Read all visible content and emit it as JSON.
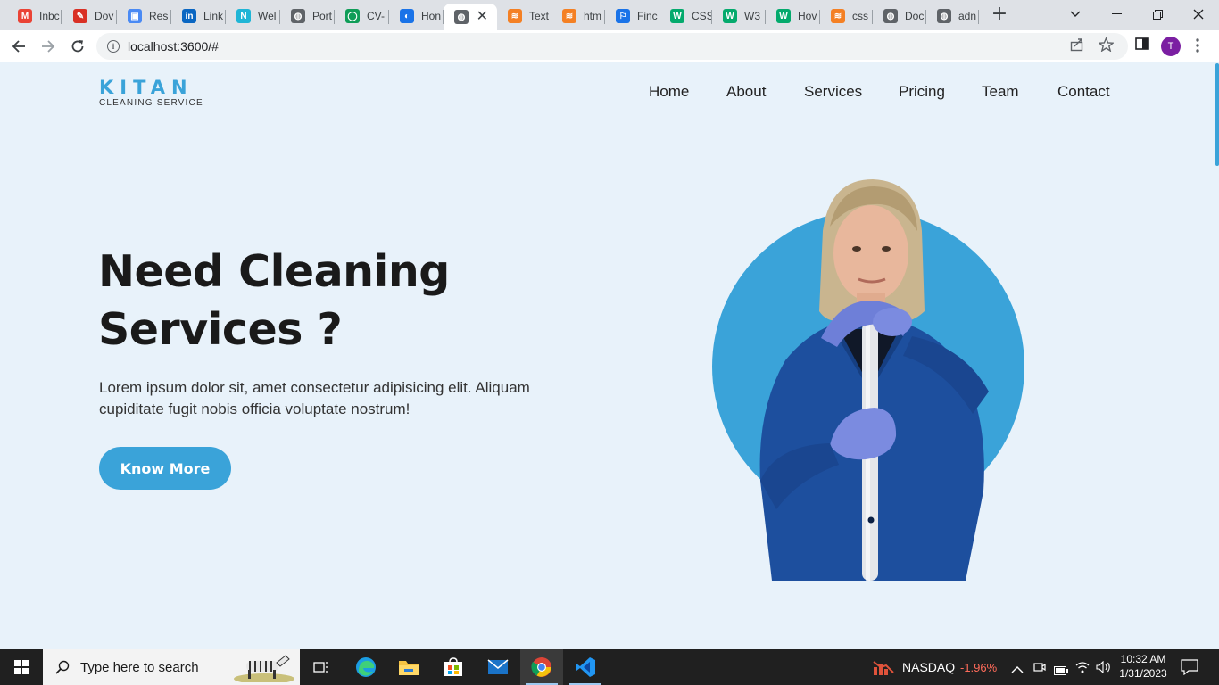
{
  "browser": {
    "tabs": [
      {
        "label": "Inbc",
        "icon": "gmail-icon",
        "color": "#ea4335",
        "glyph": "M"
      },
      {
        "label": "Dov",
        "icon": "pdf-icon",
        "color": "#d93025",
        "glyph": "✎"
      },
      {
        "label": "Res",
        "icon": "resume-icon",
        "color": "#4a8af4",
        "glyph": "▣"
      },
      {
        "label": "Link",
        "icon": "linkedin-icon",
        "color": "#0a66c2",
        "glyph": "in"
      },
      {
        "label": "Wel",
        "icon": "n-icon",
        "color": "#1fb5d6",
        "glyph": "N"
      },
      {
        "label": "Port",
        "icon": "globe-icon",
        "color": "#5f6368",
        "glyph": "◍"
      },
      {
        "label": "CV-",
        "icon": "cv-icon",
        "color": "#0f9d58",
        "glyph": "◯"
      },
      {
        "label": "Hon",
        "icon": "home-icon",
        "color": "#1a73e8",
        "glyph": "◐"
      },
      {
        "label": "",
        "icon": "globe-icon",
        "color": "#5f6368",
        "glyph": "◍"
      },
      {
        "label": "Text",
        "icon": "stackoverflow-icon",
        "color": "#f48024",
        "glyph": "≋"
      },
      {
        "label": "htm",
        "icon": "stackoverflow-icon",
        "color": "#f48024",
        "glyph": "≋"
      },
      {
        "label": "Finc",
        "icon": "flag-icon",
        "color": "#1a73e8",
        "glyph": "⚐"
      },
      {
        "label": "CSS",
        "icon": "w3schools-icon",
        "color": "#04aa6d",
        "glyph": "W"
      },
      {
        "label": "W3",
        "icon": "w3schools-icon",
        "color": "#04aa6d",
        "glyph": "W"
      },
      {
        "label": "Hov",
        "icon": "w3schools-icon",
        "color": "#04aa6d",
        "glyph": "W"
      },
      {
        "label": "css",
        "icon": "stackoverflow-icon",
        "color": "#f48024",
        "glyph": "≋"
      },
      {
        "label": "Doc",
        "icon": "globe-icon",
        "color": "#5f6368",
        "glyph": "◍"
      },
      {
        "label": "adn",
        "icon": "globe-icon",
        "color": "#5f6368",
        "glyph": "◍"
      }
    ],
    "active_tab_index": 8,
    "url": "localhost:3600/#",
    "profile_initial": "T"
  },
  "site": {
    "logo": {
      "main": "KITAN",
      "sub": "CLEANING SERVICE"
    },
    "nav": [
      "Home",
      "About",
      "Services",
      "Pricing",
      "Team",
      "Contact"
    ],
    "hero": {
      "title": "Need Cleaning Services ?",
      "text": "Lorem ipsum dolor sit, amet consectetur adipisicing elit. Aliquam cupiditate fugit nobis officia voluptate nostrum!",
      "button": "Know More"
    },
    "colors": {
      "accent": "#3aa3d9",
      "background": "#e8f2fa",
      "heading": "#1a1a1a"
    }
  },
  "taskbar": {
    "search_placeholder": "Type here to search",
    "apps": [
      "task-view-icon",
      "edge-icon",
      "file-explorer-icon",
      "store-icon",
      "mail-icon",
      "chrome-icon",
      "vscode-icon"
    ],
    "stock": {
      "name": "NASDAQ",
      "change": "-1.96%"
    },
    "time": "10:32 AM",
    "date": "1/31/2023"
  }
}
